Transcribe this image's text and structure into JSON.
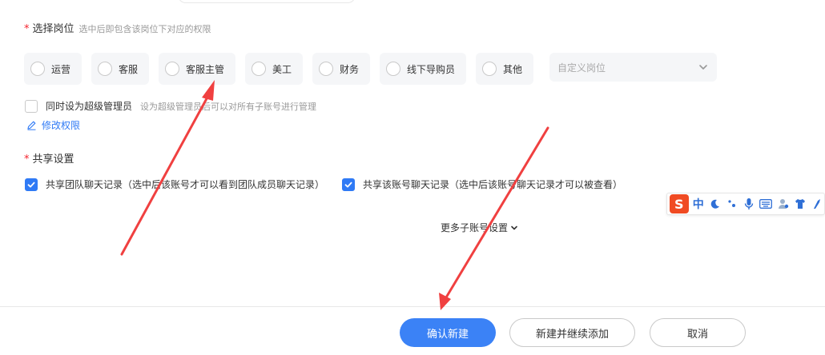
{
  "role_section": {
    "title": "选择岗位",
    "hint": "选中后即包含该岗位下对应的权限",
    "roles": [
      {
        "label": "运营"
      },
      {
        "label": "客服"
      },
      {
        "label": "客服主管"
      },
      {
        "label": "美工"
      },
      {
        "label": "财务"
      },
      {
        "label": "线下导购员"
      },
      {
        "label": "其他"
      }
    ],
    "custom_role_placeholder": "自定义岗位"
  },
  "super_admin": {
    "label": "同时设为超级管理员",
    "hint": "设为超级管理员后可以对所有子账号进行管理",
    "checked": false
  },
  "edit_permission_label": "修改权限",
  "share_section": {
    "title": "共享设置",
    "options": [
      {
        "label": "共享团队聊天记录（选中后该账号才可以看到团队成员聊天记录）",
        "checked": true
      },
      {
        "label": "共享该账号聊天记录（选中后该账号聊天记录才可以被查看）",
        "checked": true
      }
    ]
  },
  "more_settings_label": "更多子账号设置",
  "ime_toolbar": {
    "logo": "S",
    "mode": "中"
  },
  "footer": {
    "confirm_label": "确认新建",
    "create_continue_label": "新建并继续添加",
    "cancel_label": "取消"
  },
  "colors": {
    "accent": "#3b82f6",
    "required": "#f5222d",
    "arrow": "#f04040"
  }
}
